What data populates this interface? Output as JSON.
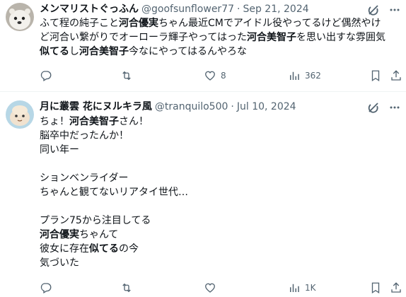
{
  "tweets": [
    {
      "display_name": "メンマリストぐっふん",
      "handle": "@goofsunflower77",
      "separator": "·",
      "date": "Sep 21, 2024",
      "lines": [
        [
          {
            "t": "ふて程の純子こと"
          },
          {
            "t": "河合優実",
            "b": true
          },
          {
            "t": "ちゃん最近CMでアイドル役やってるけど偶然やけ"
          }
        ],
        [
          {
            "t": "ど河合い繋がりでオーローラ輝子やってはった"
          },
          {
            "t": "河合美智子",
            "b": true
          },
          {
            "t": "を思い出すな雰囲気"
          }
        ],
        [
          {
            "t": "似てる",
            "b": true
          },
          {
            "t": "し"
          },
          {
            "t": "河合美智子",
            "b": true
          },
          {
            "t": "今なにやってはるんやろな"
          }
        ]
      ],
      "actions": {
        "reply": "",
        "retweet": "",
        "like": "8",
        "views": "362"
      }
    },
    {
      "display_name": "月に叢雲 花にヌルキラ風",
      "handle": "@tranquilo500",
      "separator": "·",
      "date": "Jul 10, 2024",
      "lines": [
        [
          {
            "t": "ちょ！"
          },
          {
            "t": "河合美智子",
            "b": true
          },
          {
            "t": "さん！"
          }
        ],
        [
          {
            "t": "脳卒中だったんか！"
          }
        ],
        [
          {
            "t": "同い年ー"
          }
        ],
        [],
        [
          {
            "t": "ションベンライダー"
          }
        ],
        [
          {
            "t": "ちゃんと観てないリアタイ世代…"
          }
        ],
        [],
        [
          {
            "t": "プラン75から注目してる"
          }
        ],
        [
          {
            "t": "河合優実",
            "b": true
          },
          {
            "t": "ちゃんて"
          }
        ],
        [
          {
            "t": "彼女に存在"
          },
          {
            "t": "似てる",
            "b": true
          },
          {
            "t": "の今"
          }
        ],
        [
          {
            "t": "気づいた"
          }
        ]
      ],
      "actions": {
        "reply": "",
        "retweet": "",
        "like": "",
        "views": "1K"
      }
    }
  ],
  "icons": {
    "reply": "reply-icon",
    "retweet": "retweet-icon",
    "like": "heart-icon",
    "views": "views-icon",
    "bookmark": "bookmark-icon",
    "share": "share-icon",
    "grok": "grok-icon",
    "more": "more-icon"
  },
  "colors": {
    "text": "#0f1419",
    "muted": "#536471",
    "divider": "#eff3f4"
  }
}
